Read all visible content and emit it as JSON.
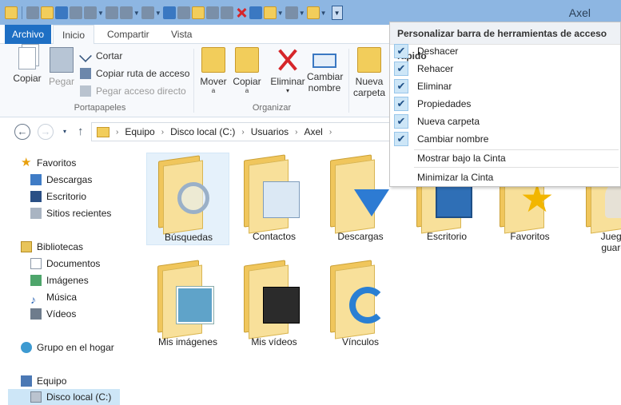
{
  "window": {
    "title": "Axel"
  },
  "ribbon_tabs": [
    "Archivo",
    "Inicio",
    "Compartir",
    "Vista"
  ],
  "clipboard": {
    "copy": "Copiar",
    "paste": "Pegar",
    "cut": "Cortar",
    "copy_path": "Copiar ruta de acceso",
    "paste_shortcut": "Pegar acceso directo",
    "group": "Portapapeles"
  },
  "organize": {
    "move_to": "Mover",
    "move_to_2": "a",
    "copy_to": "Copiar",
    "copy_to_2": "a",
    "delete": "Eliminar",
    "rename": "Cambiar",
    "rename_2": "nombre",
    "group": "Organizar"
  },
  "new_folder": {
    "line1": "Nueva",
    "line2": "carpeta"
  },
  "address": {
    "segments": [
      "Equipo",
      "Disco local (C:)",
      "Usuarios",
      "Axel"
    ]
  },
  "nav_pane": {
    "favorites": "Favoritos",
    "downloads": "Descargas",
    "desktop": "Escritorio",
    "recent": "Sitios recientes",
    "libraries": "Bibliotecas",
    "documents": "Documentos",
    "pictures": "Imágenes",
    "music": "Música",
    "videos": "Vídeos",
    "homegroup": "Grupo en el hogar",
    "computer": "Equipo",
    "local_disk": "Disco local (C:)"
  },
  "folders": [
    {
      "label": "Búsquedas",
      "icon": "search-folder-icon"
    },
    {
      "label": "Contactos",
      "icon": "contacts-folder-icon"
    },
    {
      "label": "Descargas",
      "icon": "downloads-folder-icon"
    },
    {
      "label": "Escritorio",
      "icon": "desktop-folder-icon"
    },
    {
      "label": "Favoritos",
      "icon": "favorites-folder-icon"
    },
    {
      "label": "Juegos",
      "label2": "guarda",
      "icon": "saved-games-folder-icon"
    },
    {
      "label": "Mis imágenes",
      "icon": "pictures-folder-icon"
    },
    {
      "label": "Mis vídeos",
      "icon": "videos-folder-icon"
    },
    {
      "label": "Vínculos",
      "icon": "links-folder-icon"
    }
  ],
  "qat_menu": {
    "header": "Personalizar barra de herramientas de acceso rápido",
    "items": [
      {
        "label": "Deshacer",
        "checked": true
      },
      {
        "label": "Rehacer",
        "checked": true
      },
      {
        "label": "Eliminar",
        "checked": true
      },
      {
        "label": "Propiedades",
        "checked": true
      },
      {
        "label": "Nueva carpeta",
        "checked": true
      },
      {
        "label": "Cambiar nombre",
        "checked": true
      }
    ],
    "show_below": "Mostrar bajo la Cinta",
    "minimize": "Minimizar la Cinta",
    "check_glyph": "✔"
  },
  "colors": {
    "titlebar": "#8db6e2",
    "file_tab": "#1e6fc4",
    "selection": "#cde6f7"
  }
}
